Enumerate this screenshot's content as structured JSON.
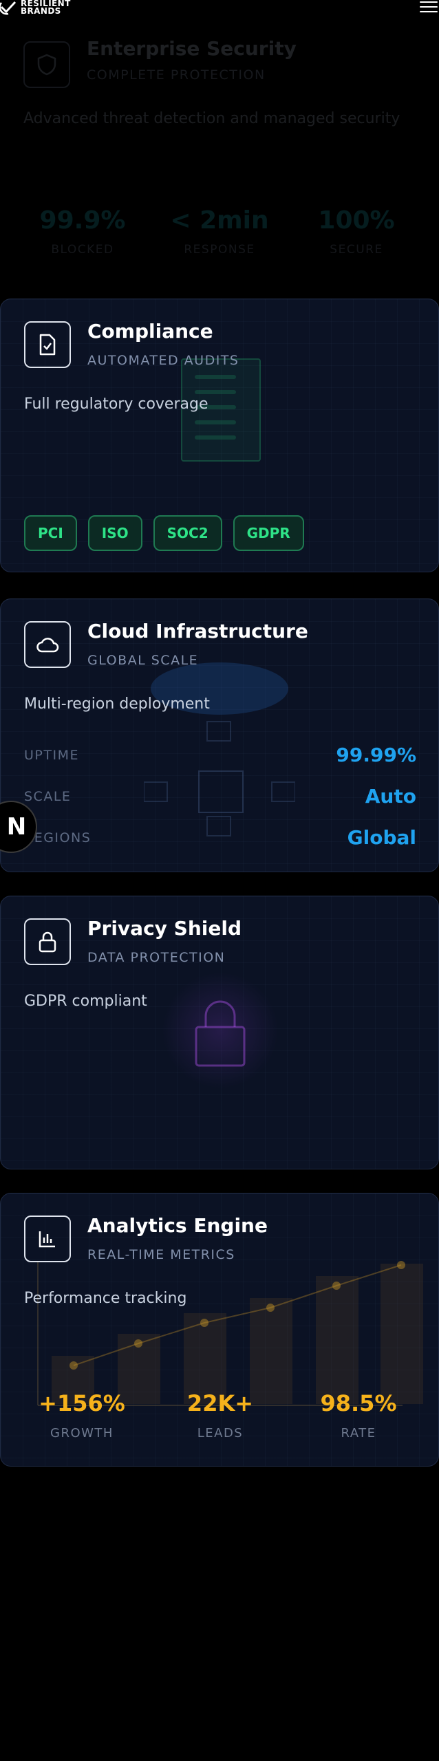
{
  "header": {
    "logo_line1": "RESILIENT",
    "logo_line2": "BRANDS",
    "menu_icon": "hamburger-menu-icon"
  },
  "cards": {
    "security": {
      "title": "Enterprise Security",
      "subtitle": "COMPLETE PROTECTION",
      "description": "Advanced threat detection and managed security",
      "icon": "shield-icon",
      "stats": [
        {
          "value": "99.9%",
          "label": "BLOCKED"
        },
        {
          "value": "< 2min",
          "label": "RESPONSE"
        },
        {
          "value": "100%",
          "label": "SECURE"
        }
      ]
    },
    "compliance": {
      "title": "Compliance",
      "subtitle": "AUTOMATED AUDITS",
      "description": "Full regulatory coverage",
      "icon": "document-check-icon",
      "tags": [
        "PCI",
        "ISO",
        "SOC2",
        "GDPR"
      ]
    },
    "cloud": {
      "title": "Cloud Infrastructure",
      "subtitle": "GLOBAL SCALE",
      "description": "Multi-region deployment",
      "icon": "cloud-icon",
      "metrics": [
        {
          "label": "UPTIME",
          "value": "99.99%"
        },
        {
          "label": "SCALE",
          "value": "Auto"
        },
        {
          "label": "REGIONS",
          "value": "Global"
        }
      ]
    },
    "privacy": {
      "title": "Privacy Shield",
      "subtitle": "DATA PROTECTION",
      "description": "GDPR compliant",
      "icon": "lock-icon"
    },
    "analytics": {
      "title": "Analytics Engine",
      "subtitle": "REAL-TIME METRICS",
      "description": "Performance tracking",
      "icon": "bar-chart-icon",
      "stats": [
        {
          "value": "+156%",
          "label": "GROWTH"
        },
        {
          "value": "22K+",
          "label": "LEADS"
        },
        {
          "value": "98.5%",
          "label": "RATE"
        }
      ]
    }
  },
  "dev_badge": {
    "letter": "N"
  },
  "colors": {
    "accent_green": "#2ee388",
    "accent_blue": "#1fa3f0",
    "accent_gold": "#f6b21b",
    "accent_teal": "#21b6c2",
    "card_bg": "#0b1224"
  }
}
